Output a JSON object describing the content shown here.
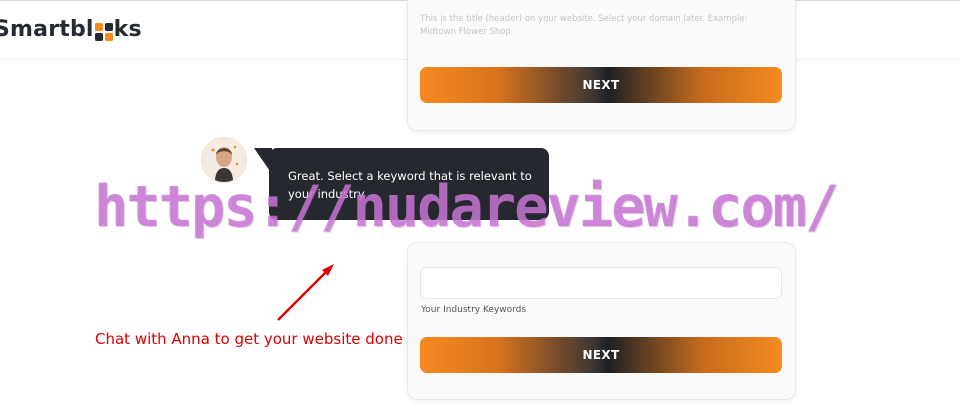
{
  "header": {
    "logo_text_before": "Smartbl",
    "logo_text_after": "ks"
  },
  "step_title": {
    "hint": "This is the title (header) on your website. Select your domain later. Example: Midtown Flower Shop",
    "next_label": "NEXT"
  },
  "chat": {
    "message": "Great. Select a keyword that is relevant to your industry"
  },
  "step_keywords": {
    "input_value": "",
    "label": "Your Industry Keywords",
    "next_label": "NEXT"
  },
  "overlay": {
    "watermark": "https://nudareview.com/",
    "annotation": "Chat with Anna to get your website done"
  },
  "colors": {
    "accent_orange": "#f58a1f",
    "dark": "#25282e",
    "annotation_red": "#dd0000",
    "watermark_purple": "#c978d4"
  }
}
